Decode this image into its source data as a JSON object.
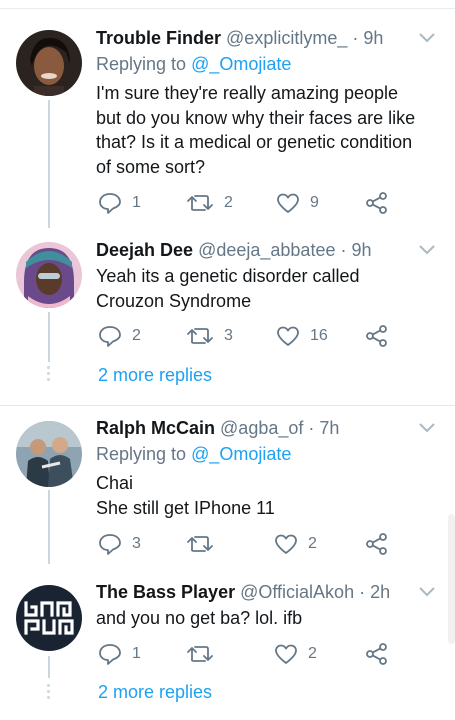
{
  "tweets": [
    {
      "name": "Trouble Finder",
      "handle": "@explicitlyme_",
      "time": "· 9h",
      "replying_label": "Replying to ",
      "replying_to": "@_Omojiate",
      "lines": [
        "I'm sure they're really amazing people",
        "but do you know why their faces are like",
        "that? Is it a medical or genetic condition",
        "of some sort?"
      ],
      "replies": "1",
      "retweets": "2",
      "likes": "9",
      "avatar_colors": [
        "#2b2320",
        "#c79a7a"
      ]
    },
    {
      "name": "Deejah Dee",
      "handle": "@deeja_abbatee",
      "time": "· 9h",
      "lines": [
        "Yeah its a genetic disorder called",
        "Crouzon Syndrome"
      ],
      "replies": "2",
      "retweets": "3",
      "likes": "16",
      "avatar_colors": [
        "#6a4a8a",
        "#e2a9c9"
      ]
    },
    {
      "name": "Ralph McCain",
      "handle": "@agba_of",
      "time": "· 7h",
      "replying_label": "Replying to ",
      "replying_to": "@_Omojiate",
      "lines": [
        "Chai",
        "She still get IPhone 11"
      ],
      "replies": "3",
      "retweets": "",
      "likes": "2",
      "avatar_colors": [
        "#5c6f7c",
        "#2c3a46"
      ]
    },
    {
      "name": "The Bass Player",
      "handle": "@OfficialAkoh",
      "time": "· 2h",
      "lines": [
        "and you no get ba? lol. ifb"
      ],
      "replies": "1",
      "retweets": "",
      "likes": "2",
      "avatar_colors": [
        "#1a2332",
        "#ffffff"
      ]
    }
  ],
  "more_replies_1": "2 more replies",
  "more_replies_2": "2 more replies",
  "colors": {
    "accent": "#1da1f2",
    "secondary": "#657786",
    "line": "#ccd6dd"
  }
}
